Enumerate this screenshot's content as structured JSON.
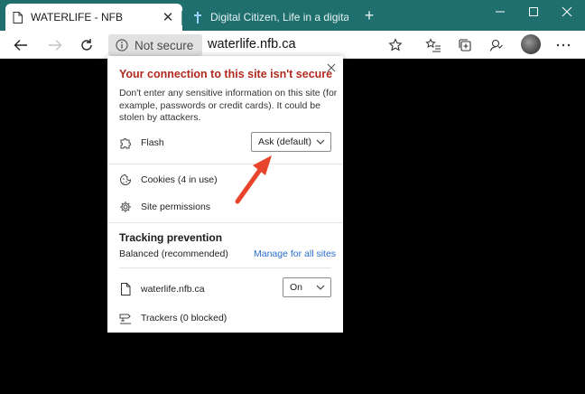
{
  "colors": {
    "titlebar": "#1f6f6f",
    "alert_red": "#b22a1f",
    "link_blue": "#2a6ecb",
    "arrow_red": "#e8442c"
  },
  "tabs": [
    {
      "title": "WATERLIFE - NFB",
      "active": true,
      "icon": "page-icon"
    },
    {
      "title": "Digital Citizen, Life in a digital wo",
      "active": false,
      "icon": "favicon-cross-icon"
    }
  ],
  "toolbar": {
    "not_secure_label": "Not secure",
    "url": "waterlife.nfb.ca"
  },
  "popup": {
    "title": "Your connection to this site isn't secure",
    "description": "Don't enter any sensitive information on this site (for example, passwords or credit cards). It could be stolen by attackers.",
    "flash": {
      "label": "Flash",
      "value": "Ask (default)"
    },
    "cookies_label": "Cookies (4 in use)",
    "site_permissions_label": "Site permissions",
    "tracking": {
      "title": "Tracking prevention",
      "level": "Balanced (recommended)",
      "manage_link": "Manage for all sites",
      "site": "waterlife.nfb.ca",
      "site_value": "On",
      "trackers": "Trackers (0 blocked)"
    }
  }
}
